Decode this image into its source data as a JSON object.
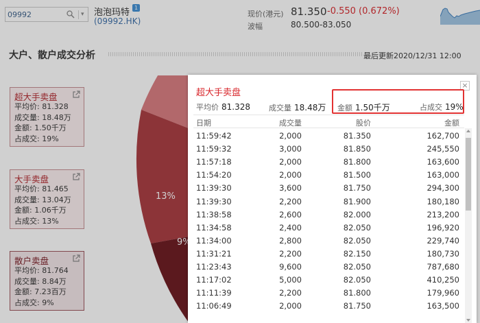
{
  "header": {
    "search_value": "09992",
    "stock_name": "泡泡玛特",
    "stock_badge": "1",
    "stock_code": "(09992.HK)",
    "price_label": "现价(港元)",
    "price": "81.350",
    "change": "-0.550 (0.672%)",
    "range_label": "波幅",
    "range": "80.500-83.050"
  },
  "section": {
    "title": "大户、散户成交分析",
    "updated": "最后更新2020/12/31 12:00"
  },
  "cards": [
    {
      "title": "超大手卖盘",
      "avg": "平均价: 81.328",
      "vol": "成交量: 18.48万",
      "amt": "金额: 1.50千万",
      "pct": "占成交: 19%"
    },
    {
      "title": "大手卖盘",
      "avg": "平均价: 81.465",
      "vol": "成交量: 13.04万",
      "amt": "金额: 1.06千万",
      "pct": "占成交: 13%"
    },
    {
      "title": "散户卖盘",
      "avg": "平均价: 81.764",
      "vol": "成交量: 8.84万",
      "amt": "金额: 7.23百万",
      "pct": "占成交: 9%"
    }
  ],
  "pie_labels": [
    "13%",
    "9%"
  ],
  "colors": {
    "accent_red": "#d8262b",
    "highlight": "#e23232",
    "pie_light": "#a8383d",
    "pie_mid": "#8a2228",
    "pie_dark": "#5a1016"
  },
  "modal": {
    "title": "超大手卖盘",
    "close": "×",
    "stats": [
      {
        "label": "平均价",
        "value": "81.328"
      },
      {
        "label": "成交量",
        "value": "18.48万"
      },
      {
        "label": "金额",
        "value": "1.50千万"
      },
      {
        "label": "占成交",
        "value": "19%"
      }
    ],
    "columns": [
      "日期",
      "成交量",
      "股价",
      "金额"
    ],
    "rows": [
      [
        "11:59:42",
        "2,000",
        "81.350",
        "162,700"
      ],
      [
        "11:59:32",
        "3,000",
        "81.850",
        "245,550"
      ],
      [
        "11:57:18",
        "2,000",
        "81.800",
        "163,600"
      ],
      [
        "11:54:20",
        "2,000",
        "81.500",
        "163,000"
      ],
      [
        "11:39:30",
        "3,600",
        "81.750",
        "294,300"
      ],
      [
        "11:39:30",
        "2,200",
        "81.900",
        "180,180"
      ],
      [
        "11:38:58",
        "2,600",
        "82.000",
        "213,200"
      ],
      [
        "11:34:58",
        "2,400",
        "82.050",
        "196,920"
      ],
      [
        "11:34:00",
        "2,800",
        "82.050",
        "229,740"
      ],
      [
        "11:31:21",
        "2,200",
        "82.150",
        "180,730"
      ],
      [
        "11:23:43",
        "9,600",
        "82.050",
        "787,680"
      ],
      [
        "11:17:02",
        "5,000",
        "82.050",
        "410,250"
      ],
      [
        "11:11:39",
        "2,200",
        "81.800",
        "179,960"
      ],
      [
        "11:06:49",
        "2,000",
        "81.750",
        "163,500"
      ]
    ]
  }
}
